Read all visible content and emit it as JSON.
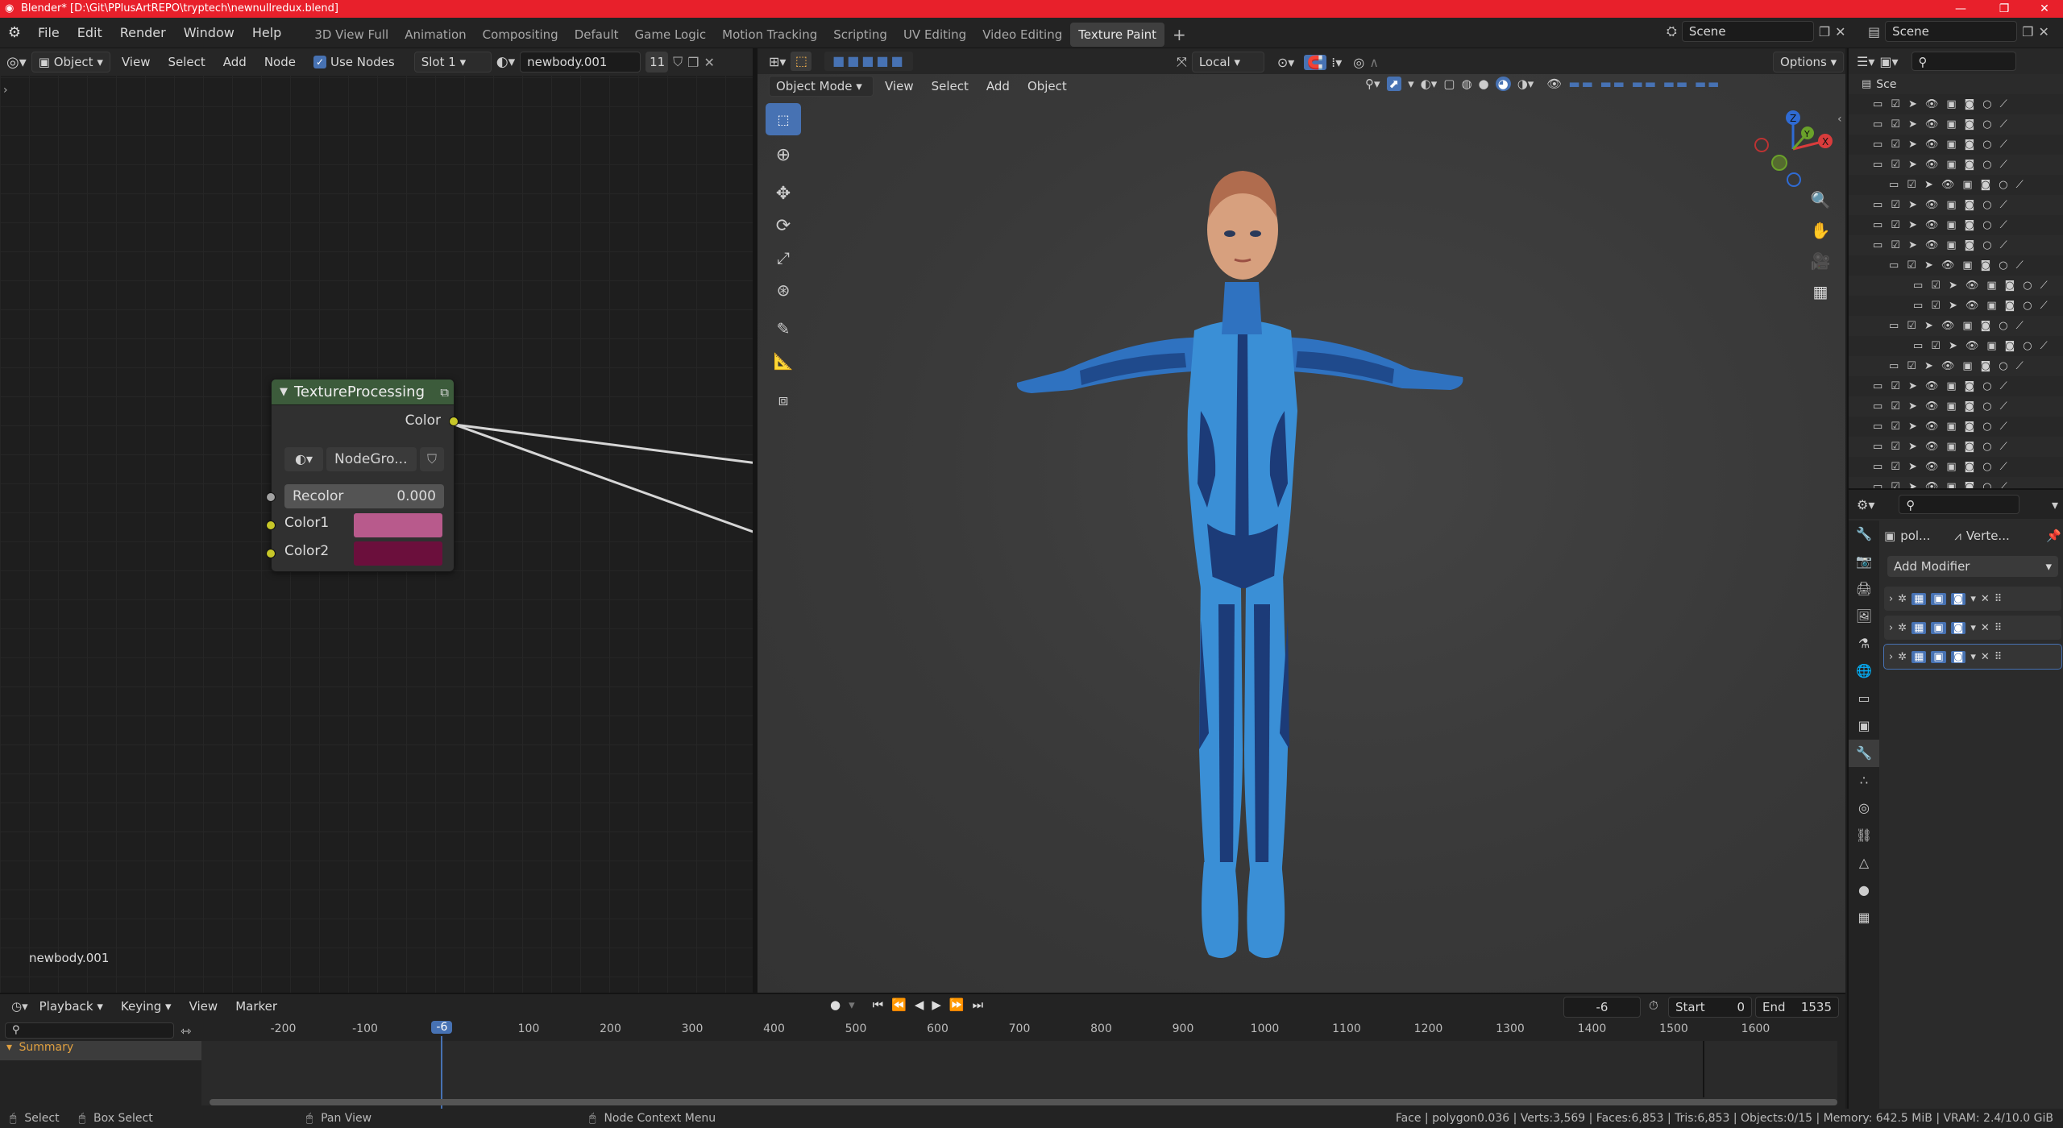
{
  "window": {
    "title": "Blender* [D:\\Git\\PPlusArtREPO\\tryptech\\newnullredux.blend]",
    "controls": [
      "—",
      "❐",
      "✕"
    ]
  },
  "topbar": {
    "menus": [
      "File",
      "Edit",
      "Render",
      "Window",
      "Help"
    ],
    "workspaces": [
      "3D View Full",
      "Animation",
      "Compositing",
      "Default",
      "Game Logic",
      "Motion Tracking",
      "Scripting",
      "UV Editing",
      "Video Editing",
      "Texture Paint"
    ],
    "active_workspace": "Texture Paint",
    "add_tab": "+",
    "scene_label": "Scene",
    "viewlayer_label": "Scene"
  },
  "node_editor": {
    "header": {
      "object_type": "Object",
      "menus": [
        "View",
        "Select",
        "Add",
        "Node"
      ],
      "use_nodes_label": "Use Nodes",
      "slot": "Slot 1",
      "material_name": "newbody.001",
      "users_count": "11"
    },
    "node": {
      "title": "TextureProcessing",
      "output_label": "Color",
      "group_name": "NodeGro...",
      "recolor_label": "Recolor",
      "recolor_value": "0.000",
      "color1_label": "Color1",
      "color1": "#b85a8c",
      "color2_label": "Color2",
      "color2": "#6b0f3c"
    },
    "footer_label": "newbody.001"
  },
  "viewport": {
    "mode": "Object Mode",
    "menus": [
      "View",
      "Select",
      "Add",
      "Object"
    ],
    "orientation": "Local",
    "options_label": "Options",
    "gizmo_axes": {
      "x": "X",
      "y": "Y",
      "z": "Z"
    }
  },
  "outliner": {
    "root_label": "Sce",
    "search_placeholder": ""
  },
  "properties": {
    "object_short": "pol...",
    "data_short": "Verte...",
    "add_modifier_label": "Add Modifier"
  },
  "timeline": {
    "menus": [
      "Playback",
      "Keying",
      "View",
      "Marker"
    ],
    "current_frame": "-6",
    "start_label": "Start",
    "start_value": "0",
    "end_label": "End",
    "end_value": "1535",
    "ruler_ticks": [
      "-200",
      "-100",
      "100",
      "200",
      "300",
      "400",
      "500",
      "600",
      "700",
      "800",
      "900",
      "1000",
      "1100",
      "1200",
      "1300",
      "1400",
      "1500",
      "1600"
    ],
    "playhead_label": "-6",
    "summary_label": "Summary"
  },
  "statusbar": {
    "select_label": "Select",
    "box_select_label": "Box Select",
    "pan_view_label": "Pan View",
    "context_menu_label": "Node Context Menu",
    "stats": "Face | polygon0.036 | Verts:3,569 | Faces:6,853 | Tris:6,853 | Objects:0/15 | Memory: 642.5 MiB | VRAM: 2.4/10.0 GiB"
  },
  "colors": {
    "title_bar": "#e8202b",
    "node_header": "#3c5b3b",
    "accent_blue": "#4772b3",
    "suit_light": "#3a8fd6",
    "suit_dark": "#1c3b78"
  }
}
